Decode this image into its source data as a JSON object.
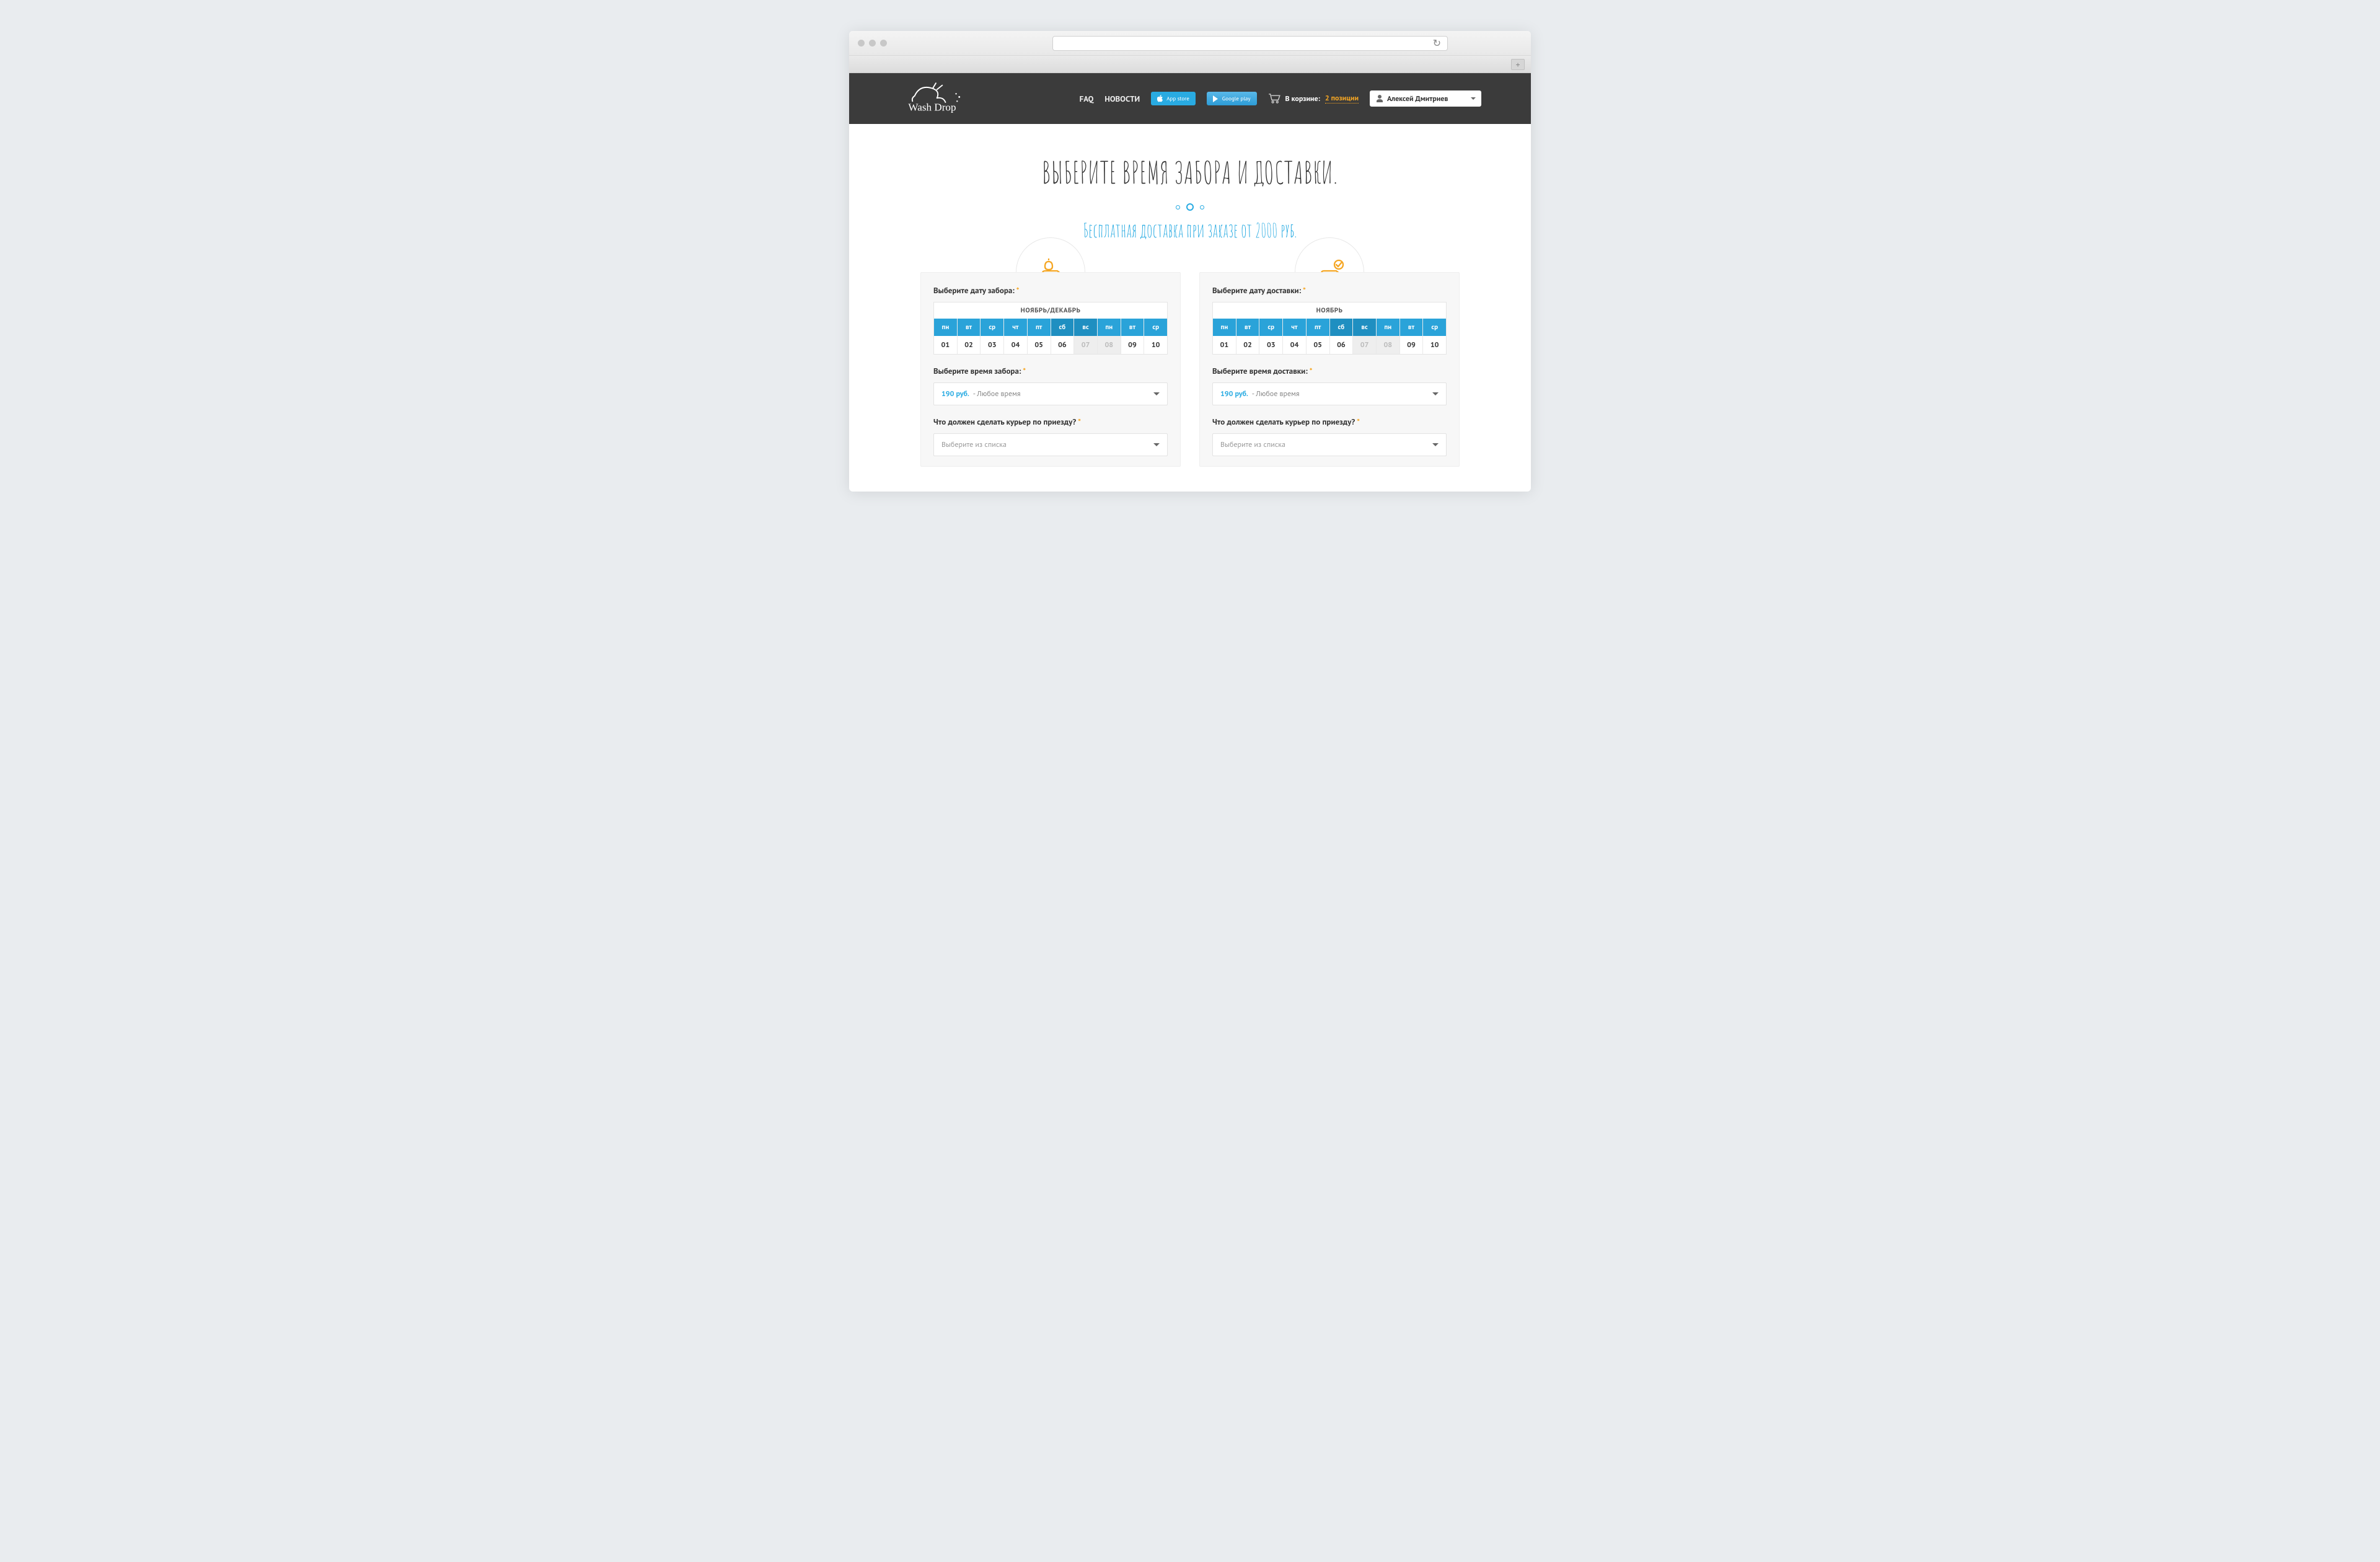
{
  "brand": "Wash Drop",
  "nav": {
    "faq": "FAQ",
    "news": "НОВОСТИ"
  },
  "stores": {
    "apple": "App store",
    "google": "Google play"
  },
  "cart": {
    "label": "В корзине:",
    "count": "2 позиции"
  },
  "user": {
    "name": "Алексей Дмитриев"
  },
  "page": {
    "title": "ВЫБЕРИТЕ ВРЕМЯ ЗАБОРА И ДОСТАВКИ.",
    "subtitle": "Бесплатная доставка при заказе от 2000 руб."
  },
  "weekdays": [
    "пн",
    "вт",
    "ср",
    "чт",
    "пт",
    "сб",
    "вс",
    "пн",
    "вт",
    "ср"
  ],
  "days": [
    "01",
    "02",
    "03",
    "04",
    "05",
    "06",
    "07",
    "08",
    "09",
    "10"
  ],
  "pickup": {
    "date_label": "Выберите дату забора:",
    "month": "НОЯБРЬ/ДЕКАБРЬ",
    "time_label": "Выберите время забора:",
    "price": "190 руб.",
    "time_text": "- Любое время",
    "action_label": "Что должен сделать курьер по приезду?",
    "action_placeholder": "Выберите из списка"
  },
  "delivery": {
    "date_label": "Выберите дату доставки:",
    "month": "НОЯБРЬ",
    "time_label": "Выберите время доставки:",
    "price": "190 руб.",
    "time_text": "- Любое время",
    "action_label": "Что должен сделать курьер по приезду?",
    "action_placeholder": "Выберите из списка"
  }
}
